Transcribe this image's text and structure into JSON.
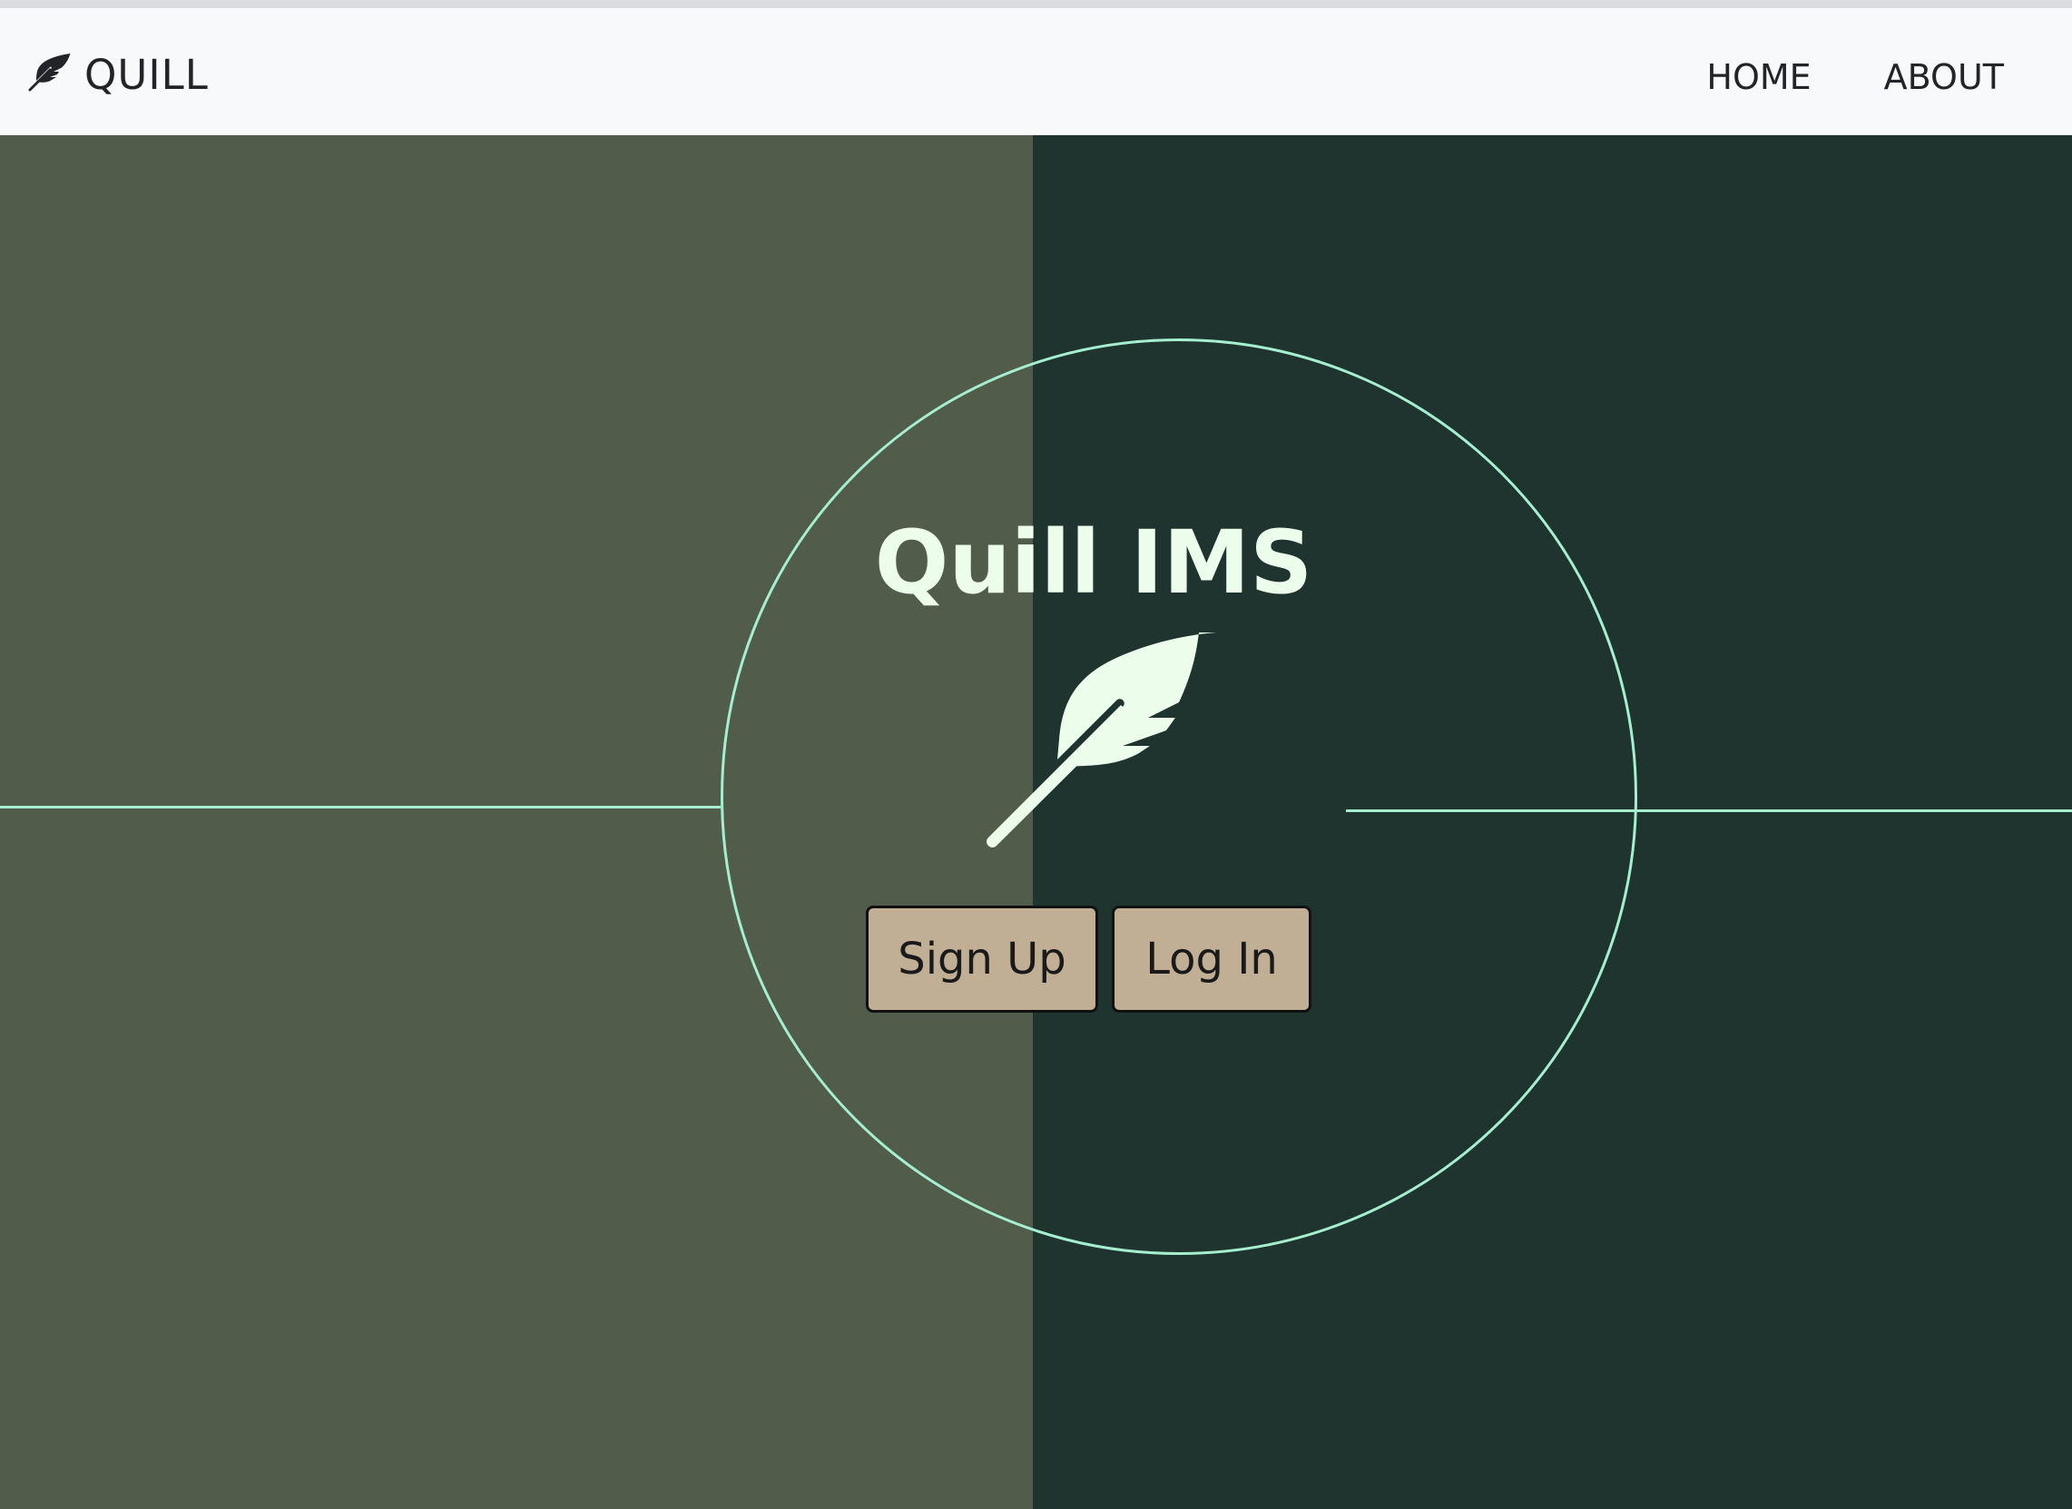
{
  "navbar": {
    "brand_icon": "feather-icon",
    "brand_text": "QUILL",
    "links": [
      {
        "label": "HOME"
      },
      {
        "label": "ABOUT"
      }
    ]
  },
  "hero": {
    "title": "Quill IMS",
    "icon": "feather-icon",
    "buttons": {
      "signup_label": "Sign Up",
      "login_label": "Log In"
    }
  },
  "colors": {
    "navbar_bg": "#f8f9fa",
    "left_panel": "#525c4b",
    "right_panel": "#1f342f",
    "accent_line": "#a5efd0",
    "title_color": "#edfdec",
    "button_bg": "#c0ae95"
  }
}
